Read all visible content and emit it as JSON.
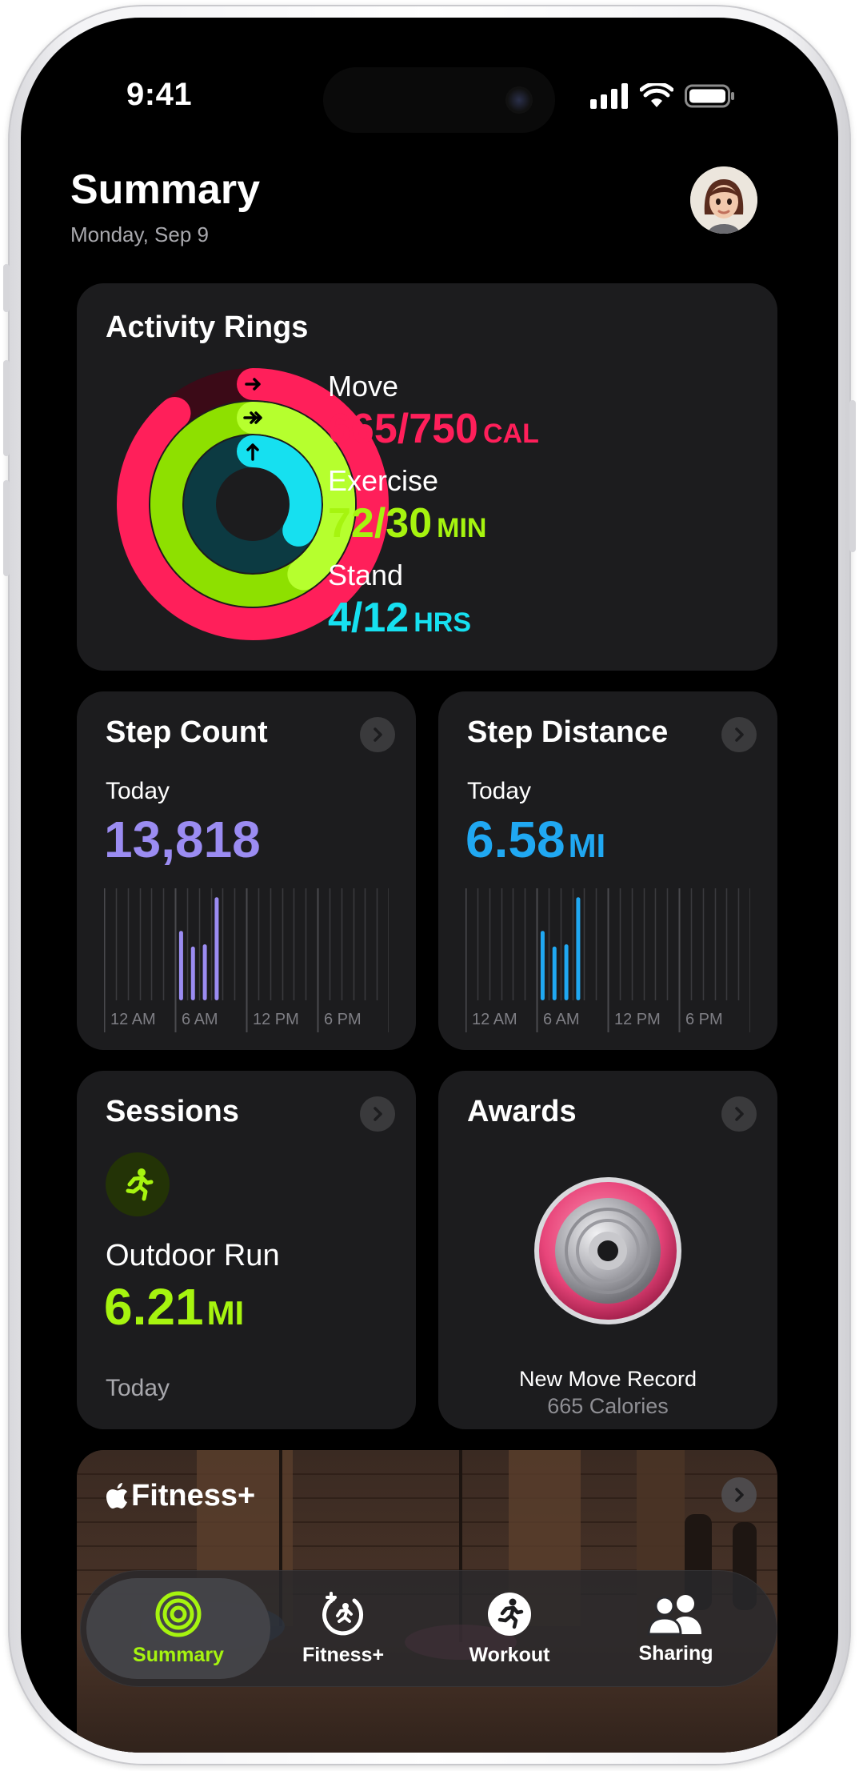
{
  "status_bar": {
    "time": "9:41"
  },
  "header": {
    "title": "Summary",
    "date": "Monday, Sep 9"
  },
  "activity": {
    "title": "Activity Rings",
    "move": {
      "label": "Move",
      "value": "665/750",
      "unit": "CAL",
      "color": "#ff1f5a"
    },
    "exercise": {
      "label": "Exercise",
      "value": "72/30",
      "unit": "MIN",
      "color": "#a6f40f"
    },
    "stand": {
      "label": "Stand",
      "value": "4/12",
      "unit": "HRS",
      "color": "#16e0f0"
    },
    "rings": {
      "move_fraction": 0.887,
      "exercise_fraction": 2.4,
      "stand_fraction": 0.333
    }
  },
  "step_count": {
    "title": "Step Count",
    "period": "Today",
    "value": "13,818",
    "color": "#9b8cf2",
    "axis": [
      "12 AM",
      "6 AM",
      "12 PM",
      "6 PM"
    ],
    "bars": [
      0,
      0,
      0,
      0,
      0,
      0,
      0.62,
      0.48,
      0.5,
      0.92,
      0,
      0,
      0,
      0,
      0,
      0,
      0,
      0,
      0,
      0,
      0,
      0,
      0,
      0
    ]
  },
  "step_distance": {
    "title": "Step Distance",
    "period": "Today",
    "value": "6.58",
    "unit": "MI",
    "color": "#20a8f2",
    "axis": [
      "12 AM",
      "6 AM",
      "12 PM",
      "6 PM"
    ],
    "bars": [
      0,
      0,
      0,
      0,
      0,
      0,
      0.62,
      0.48,
      0.5,
      0.92,
      0,
      0,
      0,
      0,
      0,
      0,
      0,
      0,
      0,
      0,
      0,
      0,
      0,
      0
    ]
  },
  "sessions": {
    "title": "Sessions",
    "activity": "Outdoor Run",
    "value": "6.21",
    "unit": "MI",
    "day": "Today",
    "color": "#a6f40f",
    "icon": "running-figure-icon"
  },
  "awards": {
    "title": "Awards",
    "award": "New Move Record",
    "detail": "665 Calories"
  },
  "fitness_plus": {
    "title": "Fitness+"
  },
  "tabs": [
    {
      "label": "Summary",
      "icon": "activity-rings-icon",
      "active": true
    },
    {
      "label": "Fitness+",
      "icon": "fitness-plus-icon",
      "active": false
    },
    {
      "label": "Workout",
      "icon": "workout-runner-icon",
      "active": false
    },
    {
      "label": "Sharing",
      "icon": "sharing-people-icon",
      "active": false
    }
  ],
  "colors": {
    "accent": "#a6f40f",
    "card": "#1c1c1e",
    "background": "#000000"
  }
}
